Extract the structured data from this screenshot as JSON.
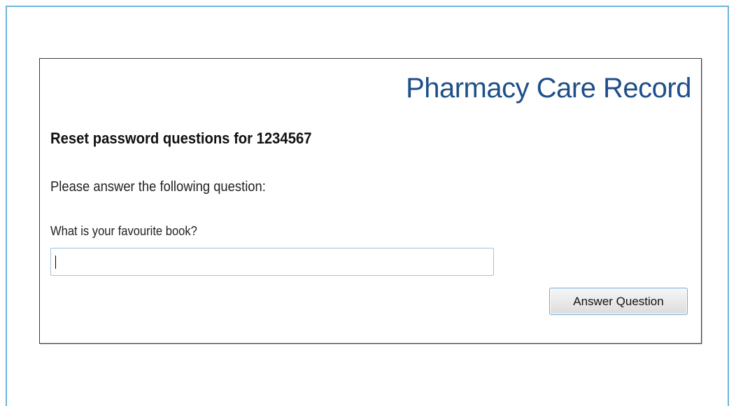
{
  "app": {
    "title": "Pharmacy Care Record"
  },
  "form": {
    "heading": "Reset password questions for 1234567",
    "instruction": "Please answer the following question:",
    "question_label": "What is your favourite book?",
    "answer_value": "",
    "answer_placeholder": "",
    "submit_label": "Answer Question"
  },
  "colors": {
    "frame_border": "#6db4dc",
    "title_text": "#1e4f8a",
    "panel_border": "#3a3a3a",
    "input_border": "#9fc3df",
    "button_border": "#6fa8cf"
  }
}
